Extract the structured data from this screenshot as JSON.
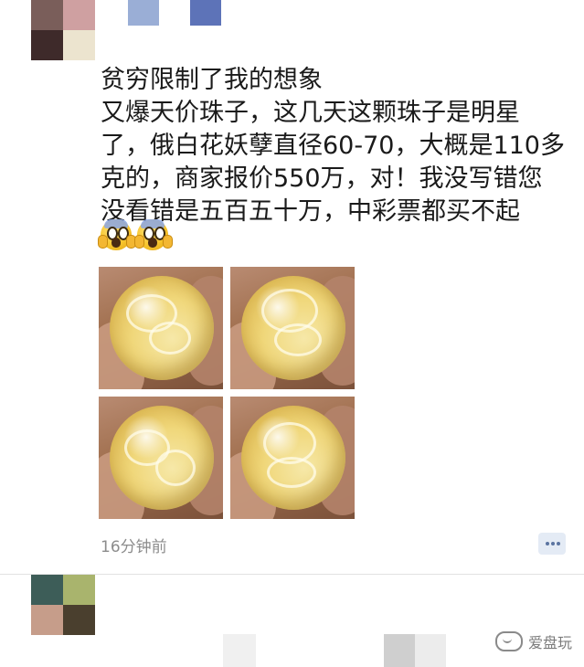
{
  "top_user": {
    "avatar_colors": [
      "#7a5e5a",
      "#cfa0a1",
      "#3e2a2a",
      "#ece4cf"
    ],
    "name_blocks": [
      "#9aaed6",
      "#5d73b8"
    ]
  },
  "post": {
    "lines": [
      "贫穷限制了我的想象",
      "又爆天价珠子，这几天这颗珠子是明星",
      "了，俄白花妖孽直径60-70，大概是110多",
      "克的，商家报价550万，对！我没写错您",
      "没看错是五百五十万，中彩票都买不起"
    ],
    "emojis": [
      "scream-emoji",
      "scream-emoji"
    ],
    "photos": [
      "amber-bead-photo-1",
      "amber-bead-photo-2",
      "amber-bead-photo-3",
      "amber-bead-photo-4"
    ],
    "timestamp": "16分钟前"
  },
  "next_user": {
    "avatar_colors": [
      "#3d5d58",
      "#a9b46d",
      "#c69d8a",
      "#4a3f2e"
    ]
  },
  "watermark": {
    "text": "爱盘玩"
  },
  "colors": {
    "text": "#1a1a1a",
    "meta": "#8c8c8c",
    "comment_button_bg": "#e4ebf5",
    "comment_icon": "#5b74a1"
  }
}
